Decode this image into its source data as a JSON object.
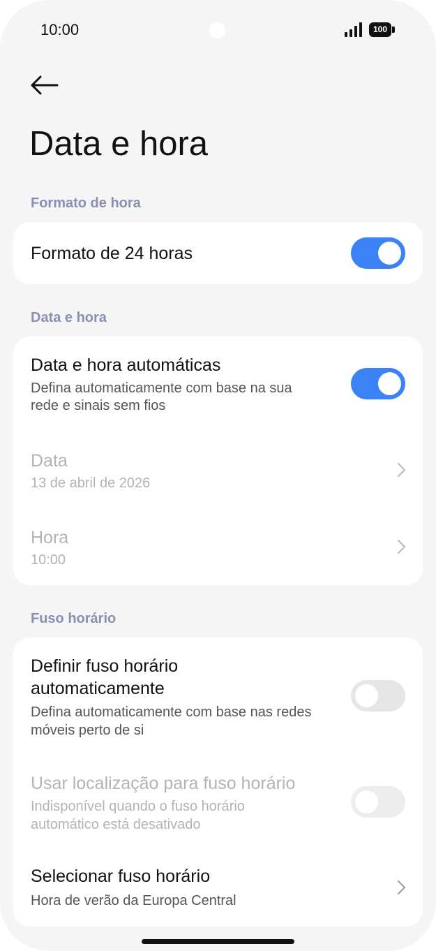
{
  "status_bar": {
    "time": "10:00",
    "battery": "100",
    "icons": [
      "signal-icon",
      "battery-icon",
      "camera-cutout"
    ]
  },
  "header": {
    "back_icon": "arrow-left-icon",
    "title": "Data e hora"
  },
  "sections": {
    "time_format": {
      "header": "Formato de hora",
      "use_24h": {
        "label": "Formato de 24 horas",
        "enabled": true
      }
    },
    "date_time": {
      "header": "Data e hora",
      "auto": {
        "label": "Data e hora automáticas",
        "description_line1": "Defina automaticamente com base na sua",
        "description_line2": "rede e sinais sem fios",
        "enabled": true
      },
      "date": {
        "label": "Data",
        "value": "13 de abril de 2026"
      },
      "time": {
        "label": "Hora",
        "value": "10:00"
      }
    },
    "time_zone": {
      "header": "Fuso horário",
      "auto_zone": {
        "label_line1": "Definir fuso horário",
        "label_line2": "automaticamente",
        "description_line1": "Defina automaticamente com base nas redes",
        "description_line2": "móveis perto de si",
        "enabled": false
      },
      "location_zone": {
        "label": "Usar localização para fuso horário",
        "description_line1": "Indisponível quando o fuso horário",
        "description_line2": "automático está desativado",
        "enabled": false
      },
      "select_zone": {
        "label": "Selecionar fuso horário",
        "value": "Hora de verão da Europa Central"
      }
    }
  },
  "colors": {
    "accent": "#3a82f6",
    "section_header": "#8a8fb3",
    "background": "#f5f5f5",
    "disabled_text": "#b3b3b3"
  }
}
